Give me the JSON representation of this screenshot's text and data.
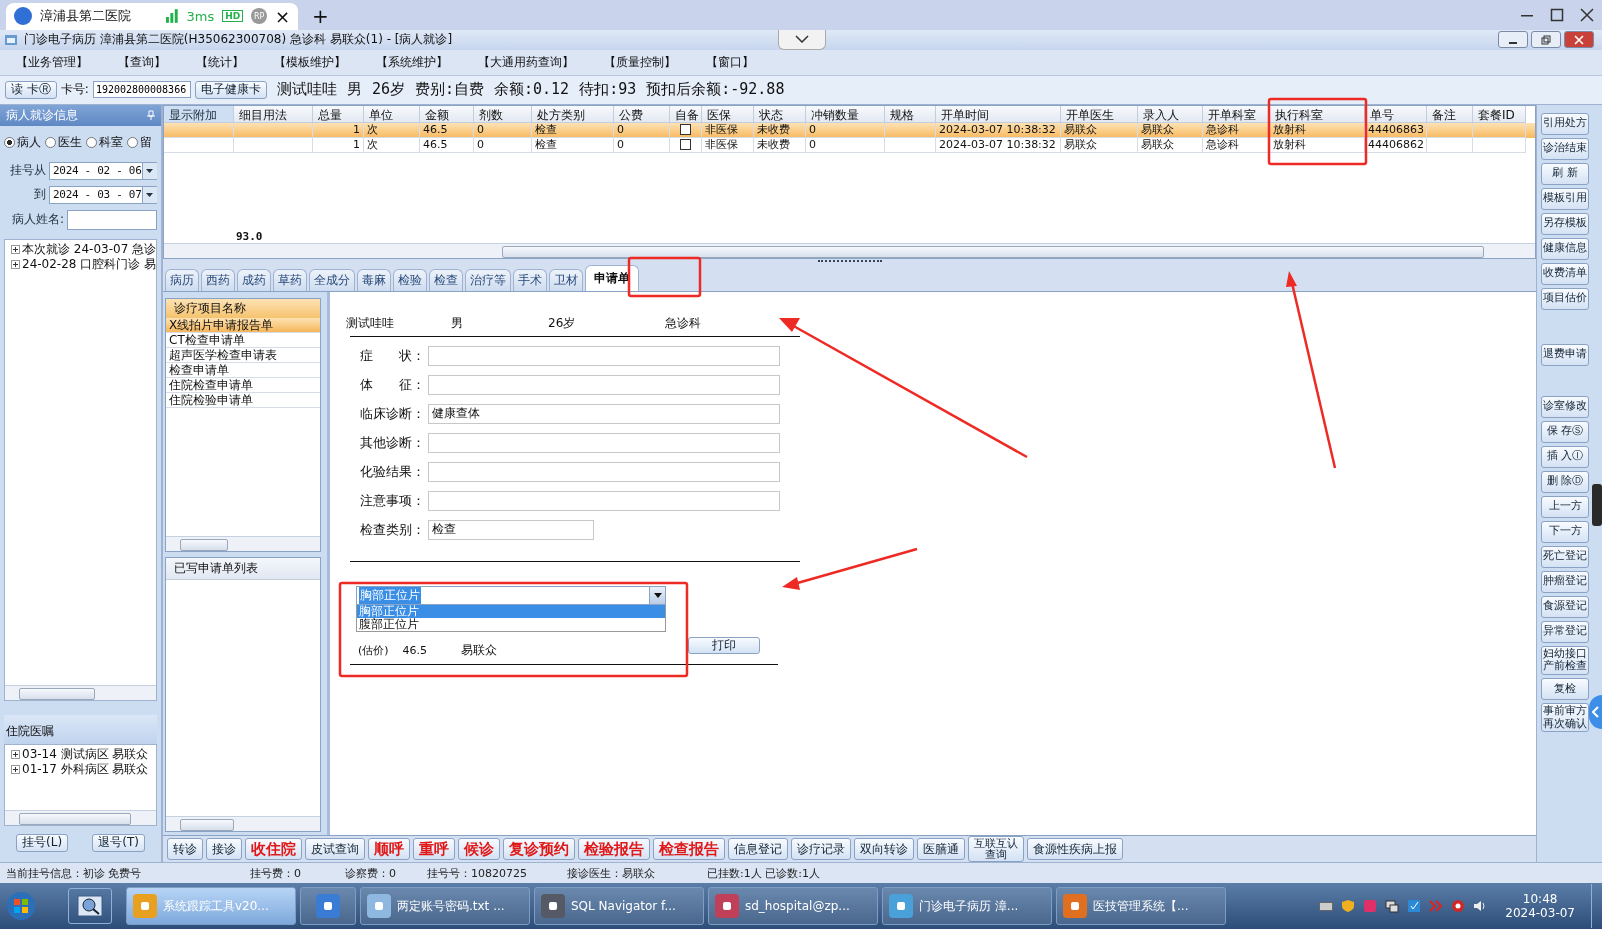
{
  "browser_tab": {
    "title": "漳浦县第二医院",
    "latency": "3ms",
    "badges": [
      "HD",
      "RP"
    ],
    "close": "×",
    "new_tab": "+"
  },
  "window": {
    "title": "门诊电子病历  漳浦县第二医院(H35062300708)  急诊科  易联众(1) - [病人就诊]"
  },
  "menu": [
    "【业务管理】",
    "【查询】",
    "【统计】",
    "【模板维护】",
    "【系统维护】",
    "【大通用药查询】",
    "【质量控制】",
    "【窗口】"
  ],
  "patient_bar": {
    "read_card": "读 卡Ⓡ",
    "card_label": "卡号:",
    "card_number": "192002800008366",
    "health_card": "电子健康卡",
    "info": [
      "测试哇哇",
      "男",
      "26岁",
      "费别:自费",
      "余额:0.12",
      "待扣:93",
      "预扣后余额:-92.88"
    ]
  },
  "left_panel": {
    "title": "病人就诊信息",
    "filters": [
      {
        "label": "病人",
        "selected": true
      },
      {
        "label": "医生",
        "selected": false
      },
      {
        "label": "科室",
        "selected": false
      },
      {
        "label": "留",
        "selected": false
      }
    ],
    "date_from_label": "挂号从",
    "date_from": "2024 - 02 - 06",
    "date_to_label": "到",
    "date_to": "2024 - 03 - 07",
    "name_label": "病人姓名:",
    "visits": [
      {
        "label": "本次就诊 24-03-07 急诊",
        "expanded": false
      },
      {
        "label": "24-02-28 口腔科门诊 易",
        "expanded": false
      }
    ],
    "inpatient_title": "住院医嘱",
    "inpatient_orders": [
      {
        "label": "03-14 测试病区 易联众",
        "expanded": false
      },
      {
        "label": "01-17 外科病区 易联众",
        "expanded": false
      }
    ],
    "buttons": [
      "挂号(L)",
      "退号(T)"
    ]
  },
  "orders_table": {
    "columns": [
      {
        "label": "显示附加",
        "kind": "text"
      },
      {
        "label": "细目用法",
        "kind": "text"
      },
      {
        "label": "总量",
        "kind": "number"
      },
      {
        "label": "单位",
        "kind": "text"
      },
      {
        "label": "金额",
        "kind": "text"
      },
      {
        "label": "剂数",
        "kind": "text"
      },
      {
        "label": "处方类别",
        "kind": "text"
      },
      {
        "label": "公费",
        "kind": "text"
      },
      {
        "label": "自备",
        "kind": "check"
      },
      {
        "label": "医保",
        "kind": "text"
      },
      {
        "label": "状态",
        "kind": "text"
      },
      {
        "label": "冲销数量",
        "kind": "text"
      },
      {
        "label": "规格",
        "kind": "text"
      },
      {
        "label": "开单时间",
        "kind": "text"
      },
      {
        "label": "开单医生",
        "kind": "text"
      },
      {
        "label": "录入人",
        "kind": "text"
      },
      {
        "label": "开单科室",
        "kind": "text"
      },
      {
        "label": "执行科室",
        "kind": "text"
      },
      {
        "label": "单号",
        "kind": "text"
      },
      {
        "label": "备注",
        "kind": "text"
      },
      {
        "label": "套餐ID",
        "kind": "text"
      }
    ],
    "rows": [
      {
        "selected": true,
        "self_pay": false,
        "cells": [
          "",
          "",
          "1",
          "次",
          "46.5",
          "0",
          "检查",
          "0",
          "",
          "非医保",
          "未收费",
          "0",
          "",
          "2024-03-07 10:38:32",
          "易联众",
          "易联众",
          "急诊科",
          "放射科",
          "44406863",
          "",
          ""
        ]
      },
      {
        "selected": false,
        "self_pay": false,
        "cells": [
          "",
          "",
          "1",
          "次",
          "46.5",
          "0",
          "检查",
          "0",
          "",
          "非医保",
          "未收费",
          "0",
          "",
          "2024-03-07 10:38:32",
          "易联众",
          "易联众",
          "急诊科",
          "放射科",
          "44406862",
          "",
          ""
        ]
      }
    ],
    "total": "93.0"
  },
  "tabs": [
    {
      "label": "病历",
      "selected": false
    },
    {
      "label": "西药",
      "selected": false
    },
    {
      "label": "成药",
      "selected": false
    },
    {
      "label": "草药",
      "selected": false
    },
    {
      "label": "全成分",
      "selected": false
    },
    {
      "label": "毒麻",
      "selected": false
    },
    {
      "label": "检验",
      "selected": false
    },
    {
      "label": "检查",
      "selected": false
    },
    {
      "label": "治疗等",
      "selected": false
    },
    {
      "label": "手术",
      "selected": false
    },
    {
      "label": "卫材",
      "selected": false
    },
    {
      "label": "申请单",
      "selected": true
    }
  ],
  "request_types": {
    "title": "诊疗项目名称",
    "items": [
      {
        "label": "X线拍片申请报告单",
        "selected": true
      },
      {
        "label": "CT检查申请单",
        "selected": false
      },
      {
        "label": "超声医学检查申请表",
        "selected": false
      },
      {
        "label": "检查申请单",
        "selected": false
      },
      {
        "label": "住院检查申请单",
        "selected": false
      },
      {
        "label": "住院检验申请单",
        "selected": false
      }
    ]
  },
  "written_requests": {
    "title": "已写申请单列表"
  },
  "request_form": {
    "patient": [
      "测试哇哇",
      "男",
      "26岁",
      "急诊科"
    ],
    "fields": [
      {
        "label": "症　　状：",
        "kind": "wide"
      },
      {
        "label": "体　　征：",
        "kind": "wide"
      },
      {
        "label": "临床诊断：",
        "value": "健康查体",
        "kind": "wide"
      },
      {
        "label": "其他诊断：",
        "kind": "wide"
      },
      {
        "label": "化验结果：",
        "kind": "wide"
      },
      {
        "label": "注意事项：",
        "kind": "wide"
      },
      {
        "label": "检查类别：",
        "value": "检查",
        "kind": "short"
      }
    ],
    "dropdown": {
      "value": "胸部正位片",
      "options": [
        {
          "label": "胸部正位片",
          "selected": true
        },
        {
          "label": "腹部正位片",
          "selected": false
        }
      ]
    },
    "estimate_label": "(估价)",
    "price": "46.5",
    "doctor": "易联众",
    "print_button": "打印"
  },
  "side_buttons": [
    [
      "引用处方",
      "诊治结束",
      "刷 新",
      "模板引用",
      "另存模板",
      "健康信息",
      "收费清单",
      "项目估价"
    ],
    [
      "退费申请"
    ],
    [
      "诊室修改",
      "保 存Ⓢ",
      "插 入Ⓘ",
      "删 除Ⓓ",
      "上一方",
      "下一方",
      "死亡登记",
      "肿瘤登记",
      "食源登记",
      "异常登记",
      "妇幼接口产前检查",
      "复检",
      "事前审方再次确认"
    ]
  ],
  "bottom_buttons": [
    {
      "label": "转诊",
      "kind": "plain"
    },
    {
      "label": "接诊",
      "kind": "plain"
    },
    {
      "label": "收住院",
      "kind": "alert"
    },
    {
      "label": "皮试查询",
      "kind": "plain"
    },
    {
      "label": "顺呼",
      "kind": "alert"
    },
    {
      "label": "重呼",
      "kind": "alert"
    },
    {
      "label": "候诊",
      "kind": "alert"
    },
    {
      "label": "复诊预约",
      "kind": "alert"
    },
    {
      "label": "检验报告",
      "kind": "alert"
    },
    {
      "label": "检查报告",
      "kind": "alert"
    },
    {
      "label": "信息登记",
      "kind": "plain"
    },
    {
      "label": "诊疗记录",
      "kind": "plain"
    },
    {
      "label": "双向转诊",
      "kind": "plain"
    },
    {
      "label": "医膳通",
      "kind": "plain"
    },
    {
      "label": "互联互认查询",
      "kind": "stacked"
    },
    {
      "label": "食源性疾病上报",
      "kind": "plain"
    }
  ],
  "status_bar": [
    "当前挂号信息：初诊 免费号",
    "挂号费：0",
    "诊察费：0",
    "挂号号：10820725",
    "接诊医生：易联众",
    "已挂数:1人 已诊数:1人"
  ],
  "taskbar": {
    "items": [
      {
        "label": "系统跟踪工具v20...",
        "color": "#e8a020",
        "selected": true
      },
      {
        "color": "#3a7bd5",
        "selected": false
      },
      {
        "label": "两定账号密码.txt ...",
        "color": "#8fb8e0",
        "selected": false
      },
      {
        "label": "SQL Navigator f...",
        "color": "#555a66",
        "selected": false
      },
      {
        "label": "sd_hospital@zp...",
        "color": "#c0405a",
        "selected": false
      },
      {
        "label": "门诊电子病历  漳...",
        "color": "#4aa0d8",
        "selected": false
      },
      {
        "label": "医技管理系统【...",
        "color": "#e07020",
        "selected": false
      }
    ],
    "time": "10:48",
    "date": "2024-03-07"
  }
}
